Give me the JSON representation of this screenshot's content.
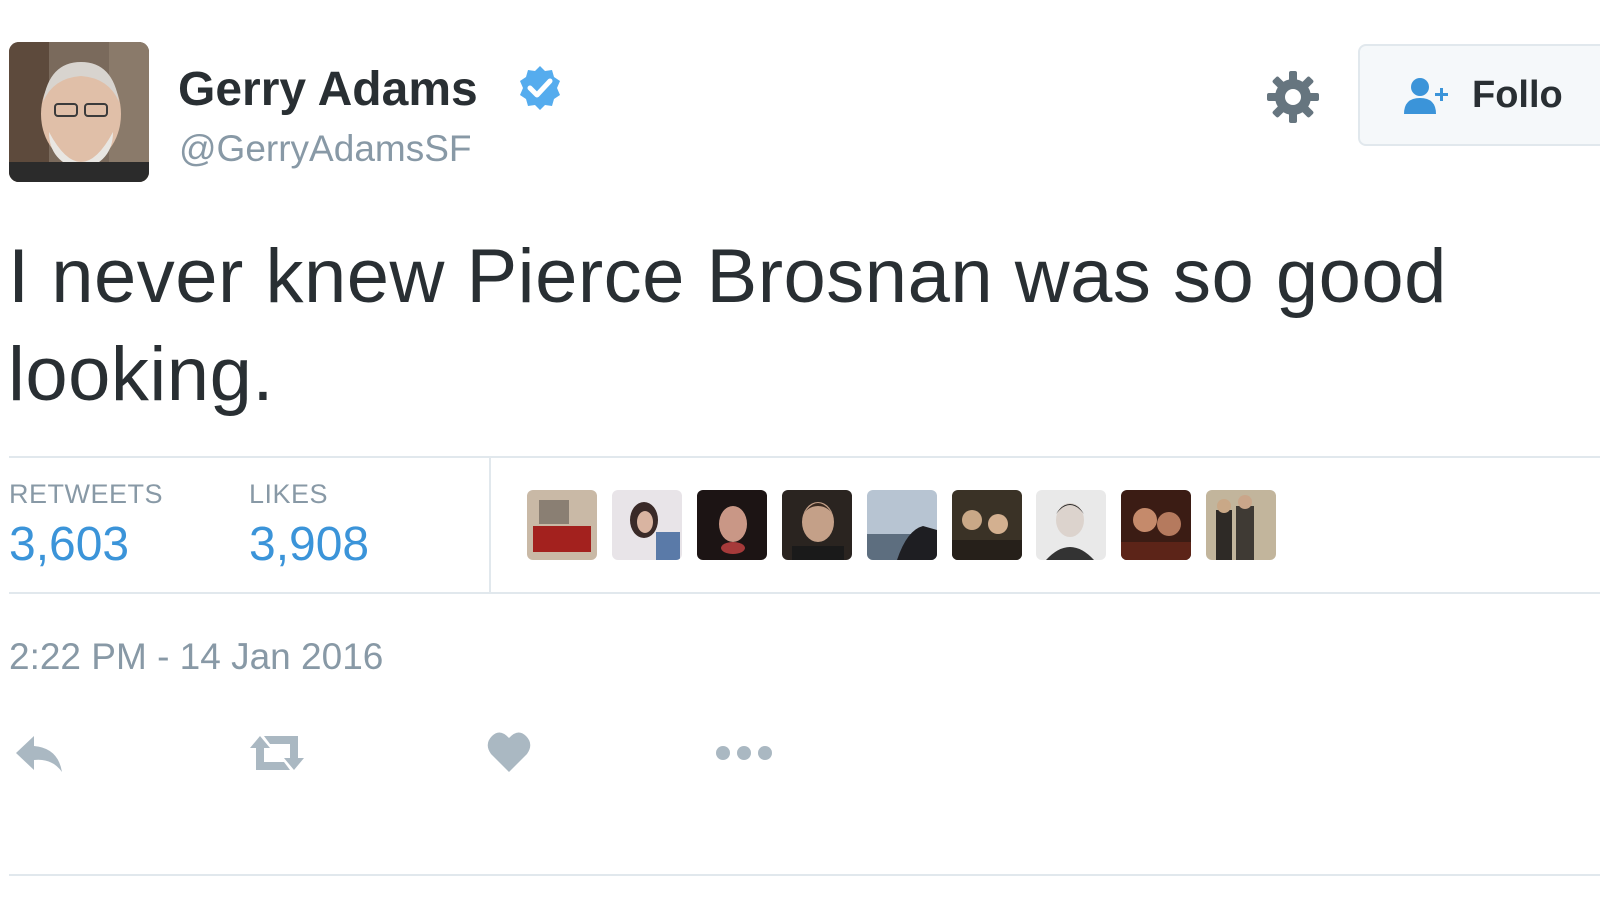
{
  "user": {
    "name": "Gerry Adams",
    "handle": "@GerryAdamsSF",
    "verified": true
  },
  "header": {
    "follow_label": "Follo"
  },
  "tweet": {
    "text_line1": "I never knew Pierce Brosnan was so good",
    "text_line2": "looking."
  },
  "stats": {
    "retweets_label": "RETWEETS",
    "retweets_value": "3,603",
    "likes_label": "LIKES",
    "likes_value": "3,908"
  },
  "timestamp": "2:22 PM - 14 Jan 2016",
  "colors": {
    "link_blue": "#3b94d9",
    "text_dark": "#292f33",
    "text_muted": "#8899a6",
    "action_gray": "#aab8c2",
    "divider": "#e1e8ed",
    "verified_blue": "#55acee"
  },
  "icons": [
    "gear-icon",
    "verified-badge-icon",
    "follow-person-icon",
    "reply-icon",
    "retweet-icon",
    "like-heart-icon",
    "more-dots-icon"
  ]
}
